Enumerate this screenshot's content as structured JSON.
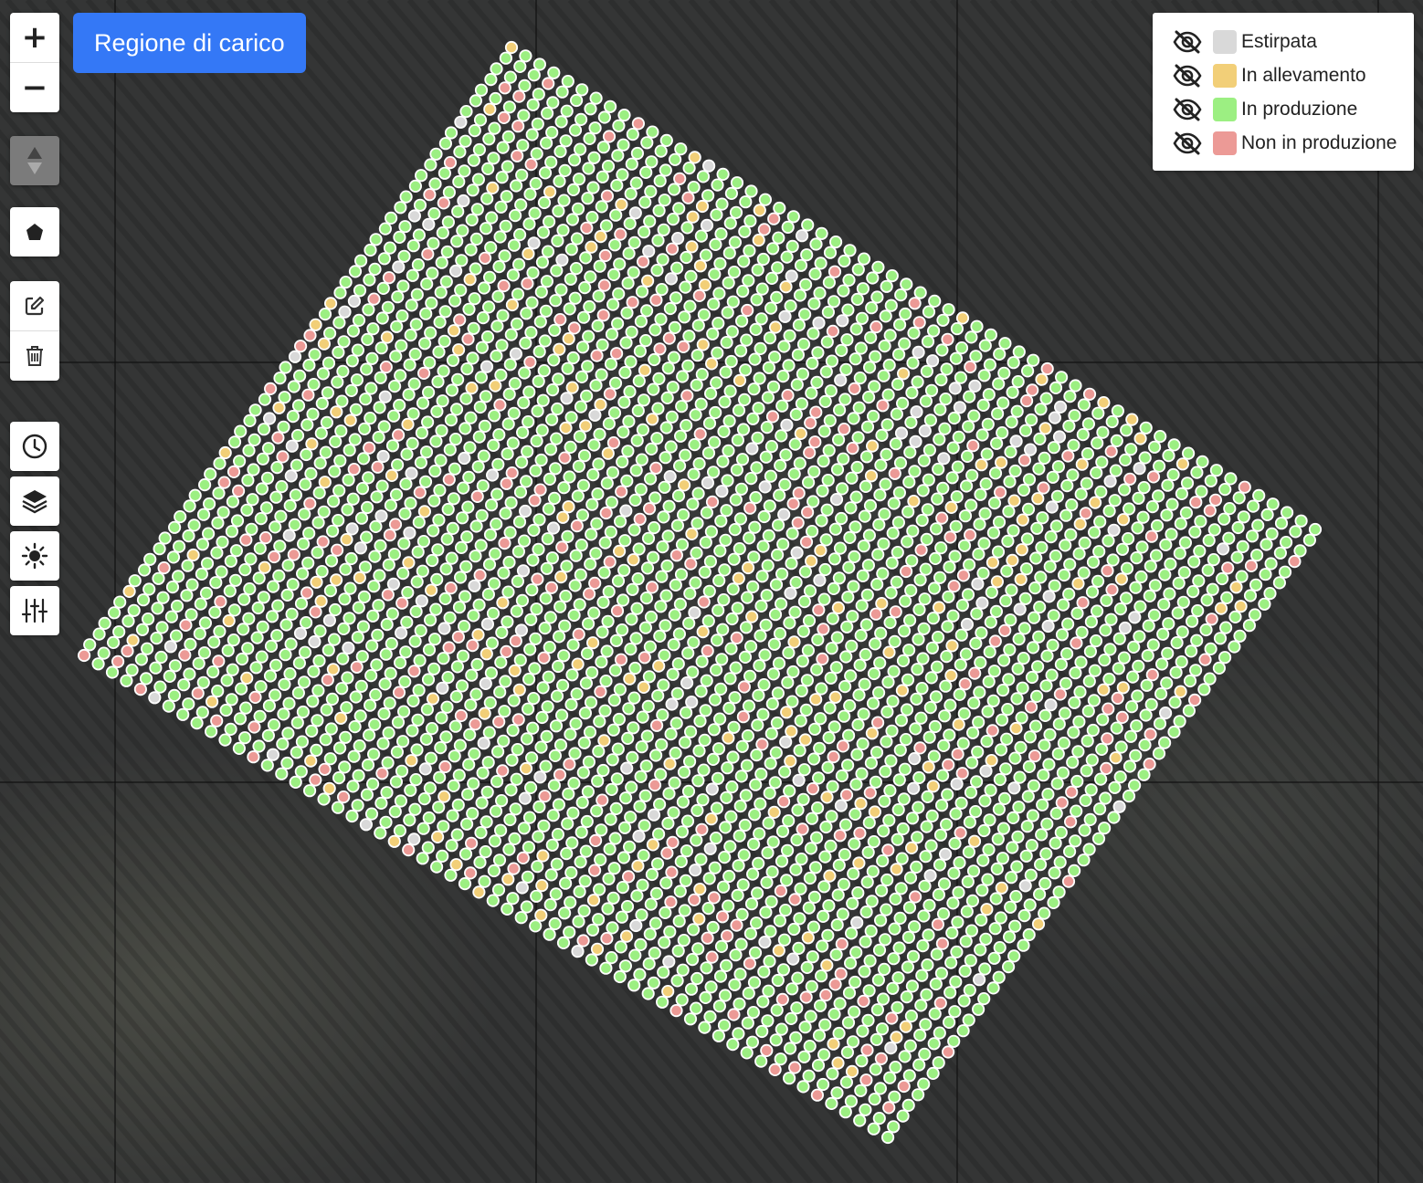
{
  "map": {
    "load_region_button": "Regione di carico",
    "zoom_in_label": "+",
    "zoom_out_label": "−"
  },
  "toolbar": {
    "tools": [
      {
        "icon": "compass-icon"
      },
      {
        "icon": "polygon-icon"
      },
      {
        "icon": "edit-icon"
      },
      {
        "icon": "trash-icon"
      },
      {
        "icon": "clock-icon"
      },
      {
        "icon": "layers-icon"
      },
      {
        "icon": "brightness-icon"
      },
      {
        "icon": "sliders-icon"
      }
    ]
  },
  "legend": {
    "items": [
      {
        "label": "Estirpata",
        "color": "#d9d9d9",
        "icon": "eye-off-icon"
      },
      {
        "label": "In allevamento",
        "color": "#f2cf78",
        "icon": "eye-off-icon"
      },
      {
        "label": "In produzione",
        "color": "#9cef82",
        "icon": "eye-off-icon"
      },
      {
        "label": "Non in produzione",
        "color": "#ec9a96",
        "icon": "eye-off-icon"
      }
    ]
  },
  "plants": {
    "status_colors": {
      "estirpata": "#d9d9d9",
      "allevamento": "#f2cf78",
      "produzione": "#9cef82",
      "non_produzione": "#ec9a96"
    },
    "status_mix": {
      "produzione": 0.82,
      "non_produzione": 0.09,
      "allevamento": 0.05,
      "estirpata": 0.04
    }
  }
}
